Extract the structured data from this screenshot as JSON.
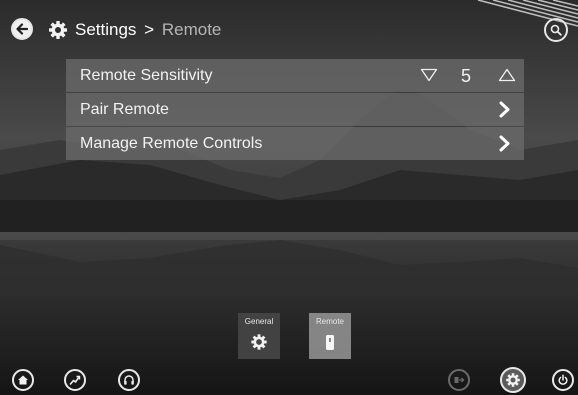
{
  "header": {
    "breadcrumb_root": "Settings",
    "breadcrumb_separator": ">",
    "breadcrumb_current": "Remote"
  },
  "menu": {
    "items": [
      {
        "label": "Remote Sensitivity",
        "value": "5"
      },
      {
        "label": "Pair Remote"
      },
      {
        "label": "Manage Remote Controls"
      }
    ]
  },
  "tabs": [
    {
      "label": "General",
      "icon": "gear-icon"
    },
    {
      "label": "Remote",
      "icon": "remote-icon",
      "selected": true
    }
  ],
  "bottom_bar": {
    "icons": [
      "home-icon",
      "activity-icon",
      "headset-icon",
      "exit-icon",
      "settings-icon",
      "power-icon"
    ]
  }
}
